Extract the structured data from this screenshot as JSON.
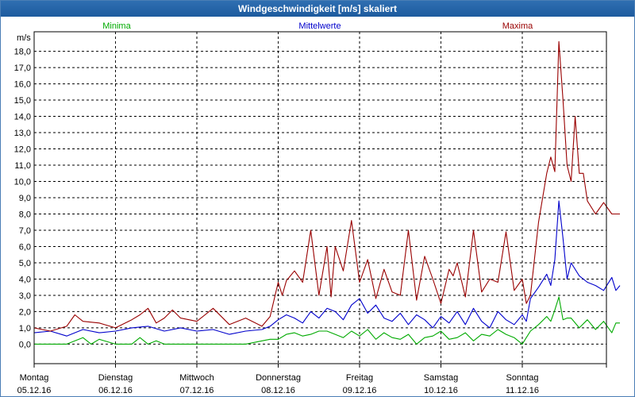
{
  "window": {
    "title": "Windgeschwindigkeit [m/s] skaliert"
  },
  "colors": {
    "min": "#00aa00",
    "avg": "#0000cc",
    "max": "#990000",
    "grid": "#000000",
    "background": "#ffffff",
    "title_bar": "#1f5fa3"
  },
  "chart_data": {
    "type": "line",
    "title": "Windgeschwindigkeit [m/s] skaliert",
    "ylabel": "m/s",
    "ylim": [
      -1.2,
      19.2
    ],
    "yticks": [
      "0,0",
      "1,0",
      "2,0",
      "3,0",
      "4,0",
      "5,0",
      "6,0",
      "7,0",
      "8,0",
      "9,0",
      "10,0",
      "11,0",
      "12,0",
      "13,0",
      "14,0",
      "15,0",
      "16,0",
      "17,0",
      "18,0"
    ],
    "grid": true,
    "legend_placement": "top",
    "days": [
      {
        "day": "Montag",
        "date": "05.12.16"
      },
      {
        "day": "Dienstag",
        "date": "06.12.16"
      },
      {
        "day": "Mittwoch",
        "date": "07.12.16"
      },
      {
        "day": "Donnerstag",
        "date": "08.12.16"
      },
      {
        "day": "Freitag",
        "date": "09.12.16"
      },
      {
        "day": "Samstag",
        "date": "10.12.16"
      },
      {
        "day": "Sonntag",
        "date": "11.12.16"
      }
    ],
    "x_note": "x in days since the start of Montag 05.12.16",
    "series": [
      {
        "name": "Minima",
        "x": [
          0,
          0.4,
          0.6,
          0.7,
          0.8,
          1.0,
          1.2,
          1.3,
          1.4,
          1.5,
          1.6,
          1.8,
          2.0,
          2.2,
          2.4,
          2.6,
          2.8,
          2.9,
          3.0,
          3.1,
          3.2,
          3.3,
          3.4,
          3.5,
          3.6,
          3.7,
          3.8,
          3.9,
          4.0,
          4.1,
          4.2,
          4.3,
          4.4,
          4.5,
          4.6,
          4.7,
          4.8,
          4.9,
          5.0,
          5.1,
          5.2,
          5.3,
          5.4,
          5.5,
          5.6,
          5.7,
          5.8,
          5.9,
          6.0,
          6.05,
          6.1,
          6.2,
          6.3,
          6.35,
          6.4,
          6.45,
          6.5,
          6.55,
          6.6,
          6.7,
          6.8,
          6.9,
          7.0,
          7.1,
          7.15,
          7.2
        ],
        "values": [
          0,
          0,
          0.4,
          0,
          0.3,
          0,
          0,
          0.4,
          0,
          0.2,
          0,
          0,
          0,
          0,
          0,
          0,
          0.2,
          0.3,
          0.3,
          0.6,
          0.7,
          0.5,
          0.6,
          0.8,
          0.8,
          0.6,
          0.4,
          0.8,
          0.5,
          0.9,
          0.3,
          0.7,
          0.4,
          0.3,
          0.6,
          0,
          0.4,
          0.5,
          0.8,
          0.3,
          0.4,
          0.7,
          0.2,
          0.6,
          0.5,
          0.9,
          0.6,
          0.4,
          0,
          0.4,
          0.8,
          1.2,
          1.7,
          1.4,
          2.1,
          2.9,
          1.5,
          1.6,
          1.6,
          1.0,
          1.5,
          0.9,
          1.4,
          0.7,
          1.3,
          1.3
        ]
      },
      {
        "name": "Mittelwerte",
        "x": [
          0,
          0.2,
          0.4,
          0.6,
          0.8,
          1.0,
          1.2,
          1.4,
          1.6,
          1.8,
          2.0,
          2.2,
          2.4,
          2.6,
          2.8,
          2.9,
          3.0,
          3.1,
          3.2,
          3.3,
          3.4,
          3.5,
          3.6,
          3.7,
          3.8,
          3.9,
          4.0,
          4.1,
          4.2,
          4.3,
          4.4,
          4.5,
          4.6,
          4.7,
          4.8,
          4.9,
          5.0,
          5.1,
          5.2,
          5.3,
          5.4,
          5.5,
          5.6,
          5.7,
          5.8,
          5.9,
          6.0,
          6.05,
          6.1,
          6.2,
          6.3,
          6.35,
          6.4,
          6.45,
          6.5,
          6.55,
          6.6,
          6.7,
          6.8,
          6.9,
          7.0,
          7.1,
          7.15,
          7.2
        ],
        "values": [
          0.7,
          0.8,
          0.5,
          0.9,
          0.7,
          0.8,
          1.0,
          1.1,
          0.8,
          1.0,
          0.8,
          0.9,
          0.6,
          0.8,
          0.9,
          1.1,
          1.5,
          1.8,
          1.6,
          1.3,
          2.0,
          1.6,
          2.2,
          2.0,
          1.5,
          2.4,
          2.8,
          1.9,
          2.4,
          1.6,
          1.4,
          1.9,
          1.2,
          1.8,
          1.5,
          1.0,
          1.7,
          1.3,
          2.0,
          1.2,
          2.2,
          1.4,
          1.0,
          2.0,
          1.5,
          1.2,
          1.8,
          1.4,
          2.8,
          3.5,
          4.3,
          3.6,
          5.2,
          8.8,
          6.5,
          4.0,
          5.0,
          4.2,
          3.8,
          3.6,
          3.3,
          4.1,
          3.3,
          3.6
        ]
      },
      {
        "name": "Maxima",
        "x": [
          0,
          0.2,
          0.4,
          0.5,
          0.6,
          0.8,
          1.0,
          1.2,
          1.3,
          1.4,
          1.5,
          1.6,
          1.7,
          1.8,
          2.0,
          2.2,
          2.4,
          2.6,
          2.8,
          2.9,
          3.0,
          3.05,
          3.1,
          3.2,
          3.3,
          3.4,
          3.5,
          3.6,
          3.65,
          3.7,
          3.8,
          3.9,
          4.0,
          4.1,
          4.2,
          4.3,
          4.4,
          4.5,
          4.6,
          4.7,
          4.8,
          4.9,
          5.0,
          5.1,
          5.15,
          5.2,
          5.3,
          5.4,
          5.5,
          5.6,
          5.7,
          5.8,
          5.9,
          6.0,
          6.05,
          6.1,
          6.2,
          6.3,
          6.35,
          6.4,
          6.45,
          6.5,
          6.55,
          6.6,
          6.65,
          6.7,
          6.75,
          6.8,
          6.9,
          7.0,
          7.1,
          7.15,
          7.2
        ],
        "values": [
          1.0,
          0.8,
          1.1,
          1.8,
          1.4,
          1.3,
          1.0,
          1.5,
          1.8,
          2.2,
          1.3,
          1.6,
          2.1,
          1.6,
          1.4,
          2.2,
          1.2,
          1.6,
          1.1,
          1.7,
          3.8,
          3.0,
          3.9,
          4.5,
          3.8,
          7.0,
          3.0,
          6.0,
          2.9,
          6.0,
          4.5,
          7.6,
          3.8,
          5.2,
          2.8,
          4.6,
          3.2,
          3.0,
          7.0,
          2.7,
          5.4,
          4.0,
          2.5,
          4.6,
          4.2,
          5.0,
          2.9,
          7.0,
          3.2,
          4.0,
          3.8,
          6.9,
          3.3,
          4.0,
          2.5,
          3.0,
          7.5,
          10.5,
          11.5,
          10.6,
          18.6,
          15.0,
          11.0,
          10.0,
          14.0,
          10.5,
          10.5,
          8.8,
          8.0,
          8.7,
          8.0,
          8.0,
          8.0
        ]
      }
    ]
  }
}
